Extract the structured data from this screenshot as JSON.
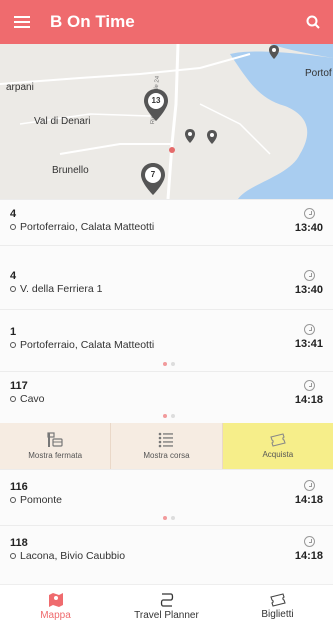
{
  "header": {
    "title": "B On Time",
    "menu_icon": "hamburger-menu-icon",
    "search_icon": "search-icon",
    "bg": "#ef6b6e"
  },
  "map": {
    "labels": [
      "arpani",
      "Val di Denari",
      "Brunello",
      "Portof",
      "Ripa di Vignale 24"
    ],
    "clusters": [
      "13",
      "7"
    ]
  },
  "departures": [
    {
      "line": "4",
      "stop": "Portoferraio, Calata Matteotti",
      "time": "13:40"
    },
    {
      "line": "4",
      "stop": "V. della Ferriera 1",
      "time": "13:40"
    },
    {
      "line": "1",
      "stop": "Portoferraio, Calata Matteotti",
      "time": "13:41"
    },
    {
      "line": "117",
      "stop": "Cavo",
      "time": "14:18"
    },
    {
      "line": "116",
      "stop": "Pomonte",
      "time": "14:18"
    },
    {
      "line": "118",
      "stop": "Lacona,  Bivio Caubbio",
      "time": "14:18"
    }
  ],
  "actions": {
    "show_stop": "Mostra fermata",
    "show_ride": "Mostra corsa",
    "buy": "Acquista"
  },
  "bottom_nav": {
    "map": "Mappa",
    "planner": "Travel Planner",
    "tickets": "Biglietti"
  }
}
